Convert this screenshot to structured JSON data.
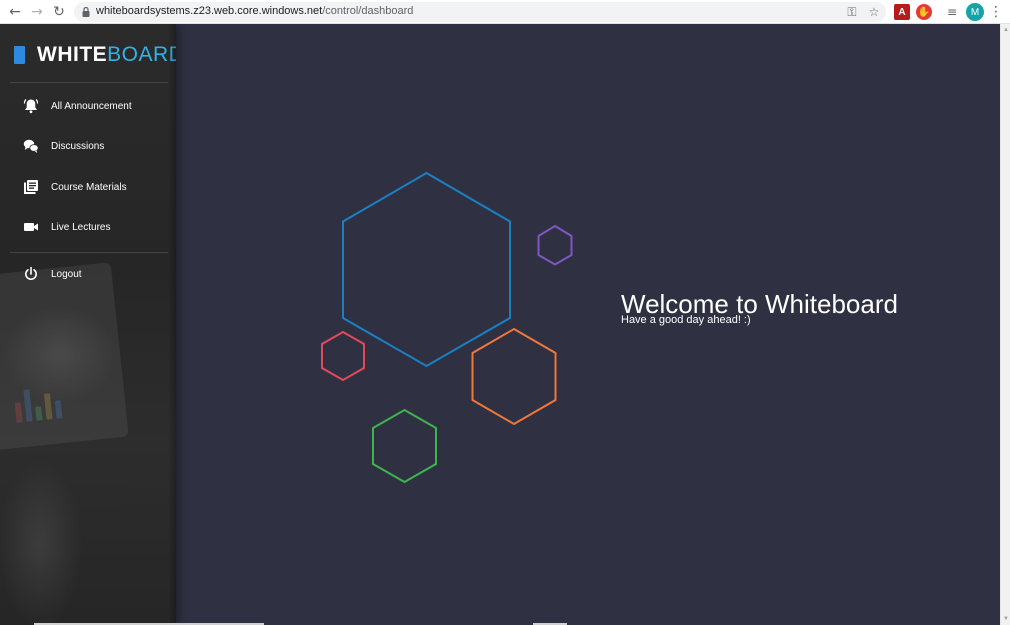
{
  "browser": {
    "url_host": "whiteboardsystems.z23.web.core.windows.net",
    "url_path": "/control/dashboard",
    "profile_initial": "M",
    "icons": [
      "back-icon",
      "forward-icon",
      "reload-icon",
      "lock-icon",
      "key-icon",
      "star-icon",
      "pdf-extension-icon",
      "adblock-extension-icon",
      "media-queue-icon",
      "menu-icon"
    ]
  },
  "brand": {
    "bold": "WHITE",
    "light": "BOARD",
    "accent_color": "#2c8be0",
    "light_color": "#2fb3e8"
  },
  "sidebar": {
    "items": [
      {
        "label": "All Announcement",
        "icon": "bell-icon"
      },
      {
        "label": "Discussions",
        "icon": "chat-icon"
      },
      {
        "label": "Course Materials",
        "icon": "library-icon"
      },
      {
        "label": "Live Lectures",
        "icon": "video-camera-icon"
      },
      {
        "label": "Logout",
        "icon": "power-icon"
      }
    ]
  },
  "main": {
    "welcome": "Welcome to Whiteboard",
    "subtitle": "Have a good day ahead! :)",
    "background": "#2f3142",
    "hex_colors": {
      "blue": "#1b7fc4",
      "purple": "#7e57c2",
      "red": "#e5485d",
      "orange": "#f0773a",
      "green": "#3fb34f"
    }
  }
}
